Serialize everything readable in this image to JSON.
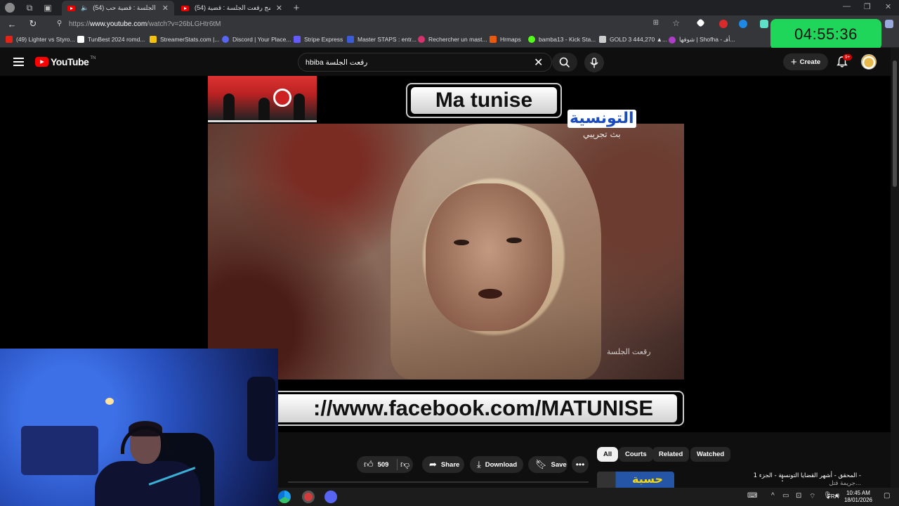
{
  "browser": {
    "tabs": [
      {
        "title": "(54) رقعت الجلسة : قضية حب"
      },
      {
        "title": "(54) برنامج رقعت الجلسة : قضية ..."
      }
    ],
    "new_tab": "+",
    "url_scheme": "https://",
    "url_host": "www.youtube.com",
    "url_path": "/watch?v=26bLGHtr6tM"
  },
  "bookmarks": [
    {
      "label": "(49) Lighter vs Styro...",
      "color": "#e62117"
    },
    {
      "label": "TunBest 2024 romd...",
      "color": "#ffffff"
    },
    {
      "label": "StreamerStats.com |...",
      "color": "#f4c20d"
    },
    {
      "label": "Discord | Your Place...",
      "color": "#5865f2"
    },
    {
      "label": "Stripe Express",
      "color": "#635bff"
    },
    {
      "label": "Master STAPS : entr...",
      "color": "#3b5bdb"
    },
    {
      "label": "Rechercher un mast...",
      "color": "#d6336c"
    },
    {
      "label": "Hrmaps",
      "color": "#e8590c"
    },
    {
      "label": "bamba13 - Kick Sta...",
      "color": "#53fc18"
    },
    {
      "label": "GOLD 3 444,270 ▲...",
      "color": "#cccccc"
    },
    {
      "label": "شوفها | Shofha - أفـ...",
      "color": "#ae3ec9"
    }
  ],
  "timer": "04:55:36",
  "youtube": {
    "logo_text": "YouTube",
    "country": "TN",
    "search_query": "hbiba رقعت الجلسة",
    "create_label": "Create",
    "notif_count": "9+"
  },
  "video": {
    "overlay_title": "Ma tunise",
    "channel_logo": "التونسية",
    "channel_sub": "بث تجريبي",
    "url_banner": "://www.facebook.com/MATUNISE",
    "corner_mark": "رقعت الجلسة"
  },
  "actions": {
    "likes": "509",
    "share": "Share",
    "download": "Download",
    "save": "Save"
  },
  "chips": [
    "All",
    "Courts",
    "Related",
    "Watched"
  ],
  "recommendation": {
    "title": "المحقق - أشهر القضايا التونسية - الجزء 1 -",
    "subtitle": "جريمة قتل...",
    "thumb_text": "حسبة"
  },
  "taskbar": {
    "lang": "FRA",
    "time": "10:45 AM",
    "date": "18/01/2026"
  }
}
